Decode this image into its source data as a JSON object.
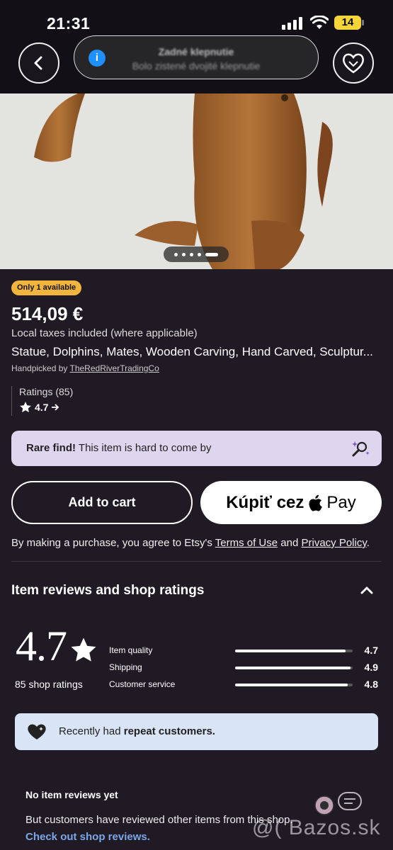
{
  "status_bar": {
    "time": "21:31",
    "battery": "14"
  },
  "toast": {
    "title": "Zadné klepnutie",
    "subtitle": "Bolo zistené dvojité klepnutie"
  },
  "listing": {
    "availability_badge": "Only 1 available",
    "price": "514,09 €",
    "taxes_note": "Local taxes included (where applicable)",
    "title": "Statue, Dolphins, Mates, Wooden Carving, Hand Carved, Sculptur...",
    "handpicked_prefix": "Handpicked by ",
    "shop_name": "TheRedRiverTradingCo",
    "ratings_label": "Ratings (85)",
    "ratings_value": "4.7",
    "image_pager": {
      "count": 5,
      "active_index": 4
    }
  },
  "rare_find": {
    "bold": "Rare find!",
    "text": " This item is hard to come by"
  },
  "buttons": {
    "add_to_cart": "Add to cart",
    "apple_pay_prefix": "Kúpiť cez",
    "apple_pay_suffix": "Pay"
  },
  "legal": {
    "prefix": "By making a purchase, you agree to Etsy's ",
    "terms": "Terms of Use",
    "and": " and ",
    "privacy": "Privacy Policy",
    "suffix": "."
  },
  "reviews": {
    "section_title": "Item reviews and shop ratings",
    "overall": "4.7",
    "shop_ratings_count": "85 shop ratings",
    "metrics": [
      {
        "label": "Item quality",
        "value": "4.7",
        "score": 4.7,
        "max": 5
      },
      {
        "label": "Shipping",
        "value": "4.9",
        "score": 4.9,
        "max": 5
      },
      {
        "label": "Customer service",
        "value": "4.8",
        "score": 4.8,
        "max": 5
      }
    ],
    "repeat_prefix": "Recently had ",
    "repeat_bold": "repeat customers.",
    "no_reviews_title": "No item reviews yet",
    "no_reviews_sub": "But customers have reviewed other items from this shop.",
    "check_link": "Check out shop reviews."
  },
  "watermark": "@( Bazos.sk",
  "colors": {
    "background": "#1f1a24",
    "badge": "#f1b53d",
    "rare_find_bg": "#ddd6ee",
    "repeat_bg": "#d9e4f7",
    "link": "#7aa7e8"
  }
}
